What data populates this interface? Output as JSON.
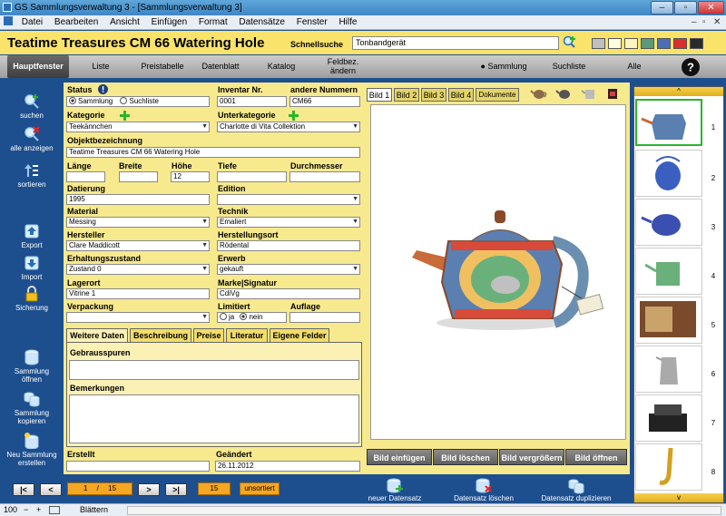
{
  "window": {
    "title": "GS Sammlungsverwaltung 3 - [Sammlungsverwaltung 3]"
  },
  "menu": [
    "Datei",
    "Bearbeiten",
    "Ansicht",
    "Einfügen",
    "Format",
    "Datensätze",
    "Fenster",
    "Hilfe"
  ],
  "header": {
    "record_title": "Teatime Treasures CM 66 Watering Hole",
    "quicksearch_label": "Schnellsuche",
    "quicksearch_value": "Tonbandgerät"
  },
  "colors": {
    "header_bg": "#f9e36a",
    "form_bg": "#f7e98e",
    "side_bg": "#1d4f8f",
    "accent_orange": "#f5a623"
  },
  "swatches": [
    "#bfbfbf",
    "#ffffe0",
    "#fff3c0",
    "#5a9a7a",
    "#4a6fb5",
    "#d93030",
    "#2a2a2a"
  ],
  "nav": {
    "items": [
      "Hauptfenster",
      "Liste",
      "Preistabelle",
      "Datenblatt",
      "Katalog"
    ],
    "feldbez_line1": "Feldbez.",
    "feldbez_line2": "ändern",
    "sammlung": "Sammlung",
    "suchliste": "Suchliste",
    "alle": "Alle"
  },
  "sidebar": {
    "suchen": "suchen",
    "alle_anzeigen": "alle anzeigen",
    "sortieren": "sortieren",
    "export": "Export",
    "import": "Import",
    "sicherung": "Sicherung",
    "sammlung_oeffnen_1": "Sammlung",
    "sammlung_oeffnen_2": "öffnen",
    "sammlung_kopieren_1": "Sammlung",
    "sammlung_kopieren_2": "kopieren",
    "neue_sammlung_1": "Neu Sammlung",
    "neue_sammlung_2": "erstellen"
  },
  "form": {
    "status_label": "Status",
    "status_opt1": "Sammlung",
    "status_opt2": "Suchliste",
    "inventar_label": "Inventar Nr.",
    "inventar_value": "0001",
    "andere_label": "andere Nummern",
    "andere_value": "CM66",
    "kategorie_label": "Kategorie",
    "kategorie_value": "Teekännchen",
    "unterkategorie_label": "Unterkategorie",
    "unterkategorie_value": "Charlotte di Vita Collektion",
    "objekt_label": "Objektbezeichnung",
    "objekt_value": "Teatime Treasures CM 66 Watering Hole",
    "laenge_label": "Länge",
    "breite_label": "Breite",
    "hoehe_label": "Höhe",
    "hoehe_value": "12",
    "tiefe_label": "Tiefe",
    "durchmesser_label": "Durchmesser",
    "datierung_label": "Datierung",
    "datierung_value": "1995",
    "edition_label": "Edition",
    "material_label": "Material",
    "material_value": "Messing",
    "technik_label": "Technik",
    "technik_value": "Emaliert",
    "hersteller_label": "Hersteller",
    "hersteller_value": "Clare Maddicott",
    "herstellungsort_label": "Herstellungsort",
    "herstellungsort_value": "Rödental",
    "erhaltung_label": "Erhaltungszustand",
    "erhaltung_value": "Zustand 0",
    "erwerb_label": "Erwerb",
    "erwerb_value": "gekauft",
    "lagerort_label": "Lagerort",
    "lagerort_value": "Vitrine 1",
    "marke_label": "Marke|Signatur",
    "marke_value": "CdiVg",
    "verpackung_label": "Verpackung",
    "limitiert_label": "Limitiert",
    "limitiert_ja": "ja",
    "limitiert_nein": "nein",
    "auflage_label": "Auflage",
    "tabs": [
      "Weitere Daten",
      "Beschreibung",
      "Preise",
      "Literatur",
      "Eigene Felder"
    ],
    "gebrauchsspuren_label": "Gebrausspuren",
    "bemerkungen_label": "Bemerkungen",
    "erstellt_label": "Erstellt",
    "geaendert_label": "Geändert",
    "geaendert_value": "26.11.2012"
  },
  "images": {
    "tabs": [
      "Bild 1",
      "Bild 2",
      "Bild 3",
      "Bild 4",
      "Dokumente"
    ],
    "buttons": [
      "Bild einfügen",
      "Bild löschen",
      "Bild vergrößern",
      "Bild öffnen"
    ]
  },
  "thumbs": {
    "up": "^",
    "down": "v",
    "numbers": [
      "1",
      "2",
      "3",
      "4",
      "5",
      "6",
      "7",
      "8"
    ]
  },
  "bottom": {
    "first": "|<",
    "prev": "<",
    "next": ">",
    "last": ">|",
    "record_pos": "1",
    "record_sep": "/",
    "record_total": "15",
    "count": "15",
    "sort": "unsortiert",
    "neuer": "neuer Datensatz",
    "loeschen": "Datensatz löschen",
    "duplizieren": "Datensatz duplizieren"
  },
  "status": {
    "zoom": "100",
    "minus": "−",
    "plus": "+",
    "mode": "Blättern"
  }
}
